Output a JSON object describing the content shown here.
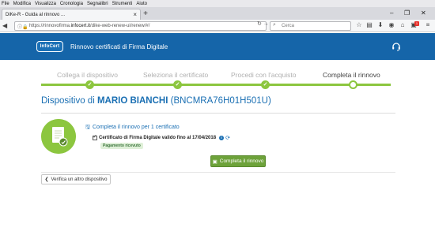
{
  "browser": {
    "menu": [
      "File",
      "Modifica",
      "Visualizza",
      "Cronologia",
      "Segnalibri",
      "Strumenti",
      "Aiuto"
    ],
    "tab_title": "DiKe-R - Guida al rinnovo ...",
    "url_prefix": "https://rinnovofirma.",
    "url_host": "infocert.it",
    "url_path": "/dike-web-renew-ui/renew/#/",
    "search_placeholder": "Cerca",
    "notification_count": "1"
  },
  "header": {
    "logo_text": "InfoCert",
    "title": "Rinnovo certificati di Firma Digitale"
  },
  "stepper": {
    "steps": [
      {
        "label": "Collega il dispositivo",
        "status": "done"
      },
      {
        "label": "Seleziona il certificato",
        "status": "done"
      },
      {
        "label": "Procedi con l'acquisto",
        "status": "done"
      },
      {
        "label": "Completa il rinnovo",
        "status": "current"
      }
    ]
  },
  "device": {
    "prefix": "Dispositivo di ",
    "owner_name": "MARIO BIANCHI",
    "fiscal_code": "(BNCMRA76H01H501U)"
  },
  "renewal": {
    "link_text": "Completa il rinnovo per 1 certificato",
    "certificate_label": "Certificato di Firma Digitale valido fino al 17/04/2018",
    "status_badge": "Pagamento ricevuto",
    "complete_button": "Completa il rinnovo",
    "verify_button": "Verifica un altro dispositivo"
  },
  "colors": {
    "brand_blue": "#1565a9",
    "accent_green": "#8cc63f",
    "button_green": "#6da23a"
  }
}
